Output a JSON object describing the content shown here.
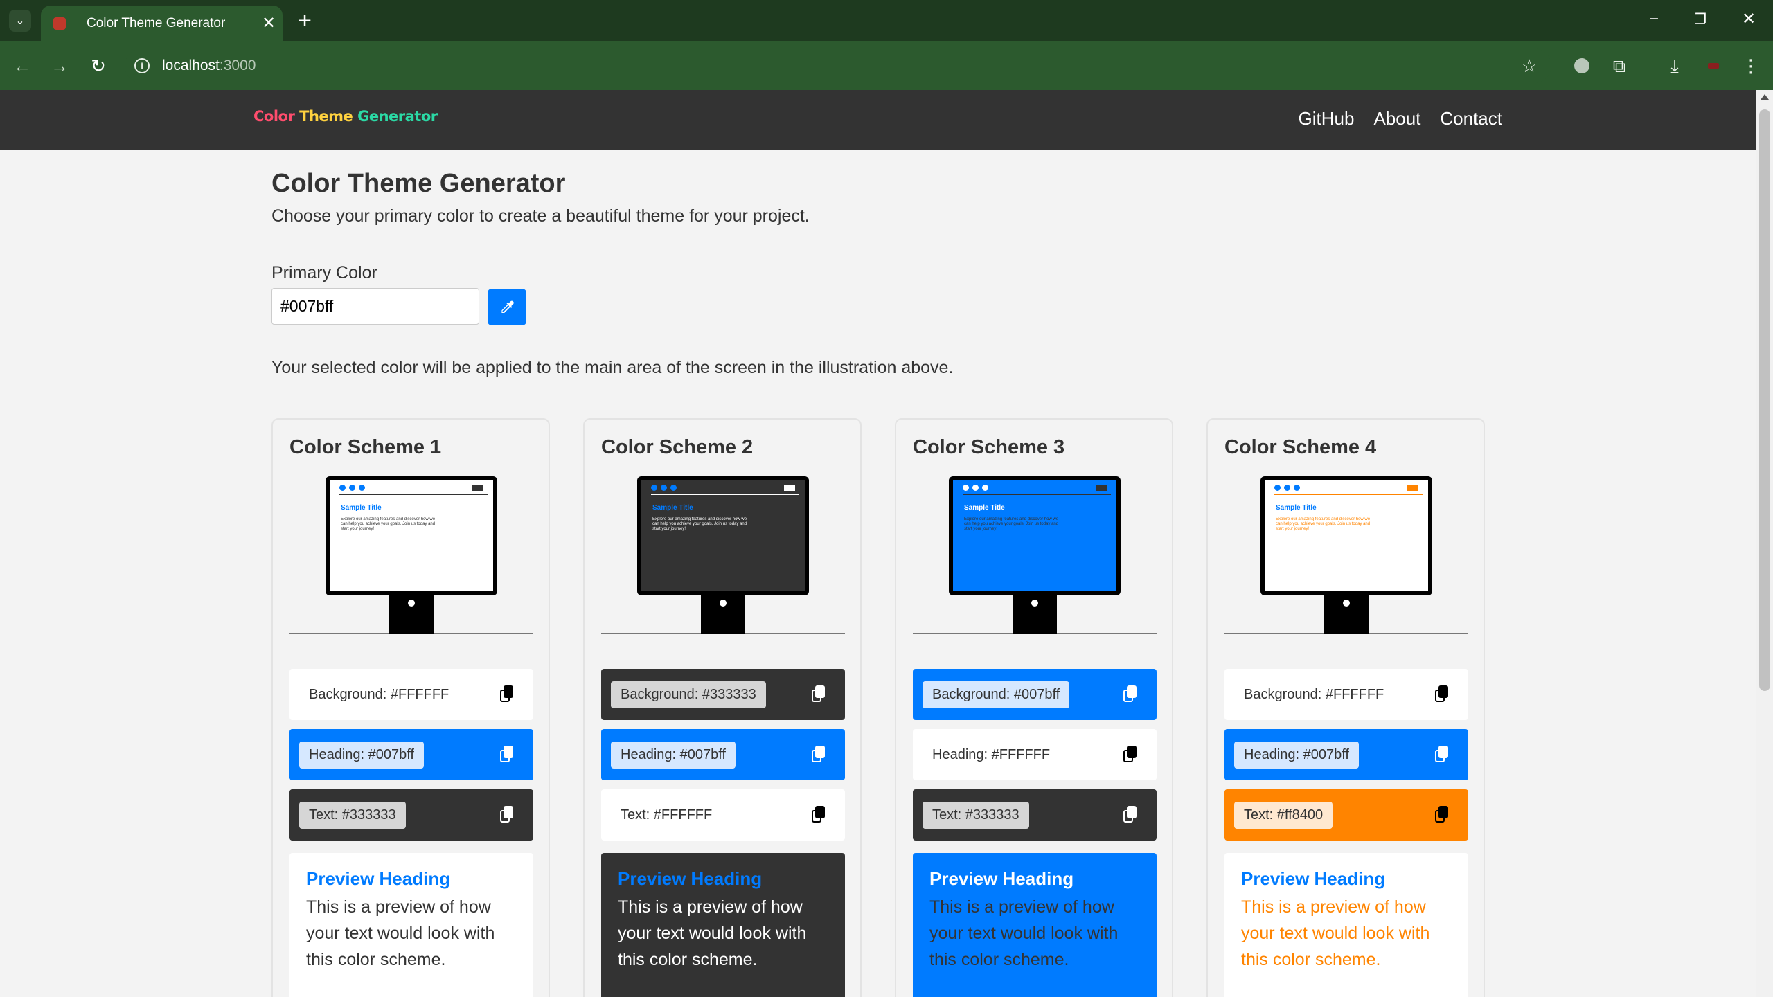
{
  "browser": {
    "tab_title": "Color Theme Generator",
    "url_host": "localhost",
    "url_port": ":3000"
  },
  "site": {
    "logo_part1": "Color",
    "logo_part2": "Theme",
    "logo_part3": "Generator",
    "nav": [
      "GitHub",
      "About",
      "Contact"
    ]
  },
  "page": {
    "title": "Color Theme Generator",
    "subtitle": "Choose your primary color to create a beautiful theme for your project.",
    "primary_label": "Primary Color",
    "primary_value": "#007bff",
    "note": "Your selected color will be applied to the main area of the screen in the illustration above."
  },
  "screen_mock": {
    "title": "Sample Title",
    "text": "Explore our amazing features and discover how we can help you achieve your goals. Join us today and start your journey!"
  },
  "schemes": [
    {
      "title": "Color Scheme 1",
      "bg": "#FFFFFF",
      "heading": "#007bff",
      "text": "#333333",
      "background_label": "Background: #FFFFFF",
      "heading_label": "Heading: #007bff",
      "text_label": "Text: #333333",
      "preview_heading": "Preview Heading",
      "preview_text": "This is a preview of how your text would look with this color scheme."
    },
    {
      "title": "Color Scheme 2",
      "bg": "#333333",
      "heading": "#007bff",
      "text": "#FFFFFF",
      "background_label": "Background: #333333",
      "heading_label": "Heading: #007bff",
      "text_label": "Text: #FFFFFF",
      "preview_heading": "Preview Heading",
      "preview_text": "This is a preview of how your text would look with this color scheme."
    },
    {
      "title": "Color Scheme 3",
      "bg": "#007bff",
      "heading": "#FFFFFF",
      "text": "#333333",
      "background_label": "Background: #007bff",
      "heading_label": "Heading: #FFFFFF",
      "text_label": "Text: #333333",
      "preview_heading": "Preview Heading",
      "preview_text": "This is a preview of how your text would look with this color scheme."
    },
    {
      "title": "Color Scheme 4",
      "bg": "#FFFFFF",
      "heading": "#007bff",
      "text": "#ff8400",
      "background_label": "Background: #FFFFFF",
      "heading_label": "Heading: #007bff",
      "text_label": "Text: #ff8400",
      "preview_heading": "Preview Heading",
      "preview_text": "This is a preview of how your text would look with this color scheme."
    }
  ],
  "icons": {
    "eyedropper": "eyedropper-icon",
    "copy": "copy-icon"
  }
}
